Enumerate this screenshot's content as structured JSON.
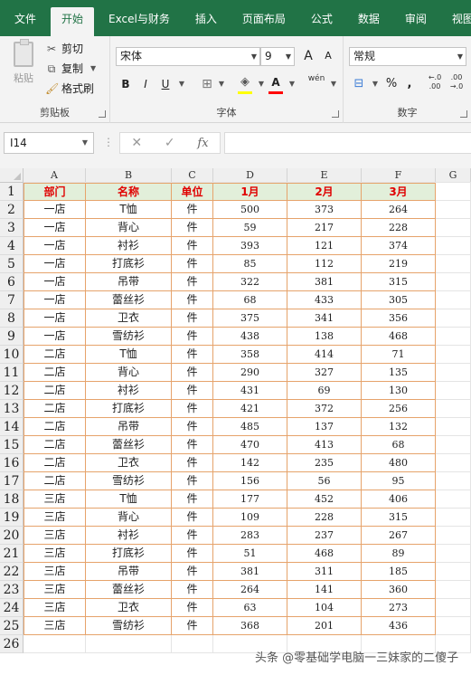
{
  "ribbon": {
    "tabs": [
      "文件",
      "开始",
      "Excel与财务",
      "插入",
      "页面布局",
      "公式",
      "数据",
      "审阅",
      "视图"
    ],
    "active_tab": 1,
    "clipboard": {
      "paste": "粘贴",
      "cut": "剪切",
      "copy": "复制",
      "format_painter": "格式刷",
      "label": "剪贴板"
    },
    "font": {
      "name": "宋体",
      "size": "9",
      "grow": "A",
      "shrink": "A",
      "bold": "B",
      "italic": "I",
      "underline": "U",
      "font_color_letter": "A",
      "wen": "wén",
      "label": "字体",
      "fill_color": "#ffff00",
      "text_color": "#ff0000"
    },
    "number": {
      "format": "常规",
      "percent": "%",
      "comma": ",",
      "inc_decimal": "←.0 .00",
      "dec_decimal": ".00 →.0",
      "label": "数字"
    }
  },
  "formula_bar": {
    "name_box": "I14",
    "cancel": "✕",
    "enter": "✓",
    "fx": "fx",
    "content": ""
  },
  "sheet": {
    "columns": [
      "A",
      "B",
      "C",
      "D",
      "E",
      "F",
      "G"
    ],
    "header_row": [
      "部门",
      "名称",
      "单位",
      "1月",
      "2月",
      "3月"
    ],
    "rows": [
      [
        "一店",
        "T恤",
        "件",
        "500",
        "373",
        "264"
      ],
      [
        "一店",
        "背心",
        "件",
        "59",
        "217",
        "228"
      ],
      [
        "一店",
        "衬衫",
        "件",
        "393",
        "121",
        "374"
      ],
      [
        "一店",
        "打底衫",
        "件",
        "85",
        "112",
        "219"
      ],
      [
        "一店",
        "吊带",
        "件",
        "322",
        "381",
        "315"
      ],
      [
        "一店",
        "蕾丝衫",
        "件",
        "68",
        "433",
        "305"
      ],
      [
        "一店",
        "卫衣",
        "件",
        "375",
        "341",
        "356"
      ],
      [
        "一店",
        "雪纺衫",
        "件",
        "438",
        "138",
        "468"
      ],
      [
        "二店",
        "T恤",
        "件",
        "358",
        "414",
        "71"
      ],
      [
        "二店",
        "背心",
        "件",
        "290",
        "327",
        "135"
      ],
      [
        "二店",
        "衬衫",
        "件",
        "431",
        "69",
        "130"
      ],
      [
        "二店",
        "打底衫",
        "件",
        "421",
        "372",
        "256"
      ],
      [
        "二店",
        "吊带",
        "件",
        "485",
        "137",
        "132"
      ],
      [
        "二店",
        "蕾丝衫",
        "件",
        "470",
        "413",
        "68"
      ],
      [
        "二店",
        "卫衣",
        "件",
        "142",
        "235",
        "480"
      ],
      [
        "二店",
        "雪纺衫",
        "件",
        "156",
        "56",
        "95"
      ],
      [
        "三店",
        "T恤",
        "件",
        "177",
        "452",
        "406"
      ],
      [
        "三店",
        "背心",
        "件",
        "109",
        "228",
        "315"
      ],
      [
        "三店",
        "衬衫",
        "件",
        "283",
        "237",
        "267"
      ],
      [
        "三店",
        "打底衫",
        "件",
        "51",
        "468",
        "89"
      ],
      [
        "三店",
        "吊带",
        "件",
        "381",
        "311",
        "185"
      ],
      [
        "三店",
        "蕾丝衫",
        "件",
        "264",
        "141",
        "360"
      ],
      [
        "三店",
        "卫衣",
        "件",
        "63",
        "104",
        "273"
      ],
      [
        "三店",
        "雪纺衫",
        "件",
        "368",
        "201",
        "436"
      ]
    ],
    "row_numbers": [
      "1",
      "2",
      "3",
      "4",
      "5",
      "6",
      "7",
      "8",
      "9",
      "10",
      "11",
      "12",
      "13",
      "14",
      "15",
      "16",
      "17",
      "18",
      "19",
      "20",
      "21",
      "22",
      "23",
      "24",
      "25",
      "26"
    ],
    "header_fill": "#e2efda",
    "header_text_color": "#e00000",
    "border_color": "#e6a36b"
  },
  "watermark": "头条 @零基础学电脑一三妹家的二傻子"
}
